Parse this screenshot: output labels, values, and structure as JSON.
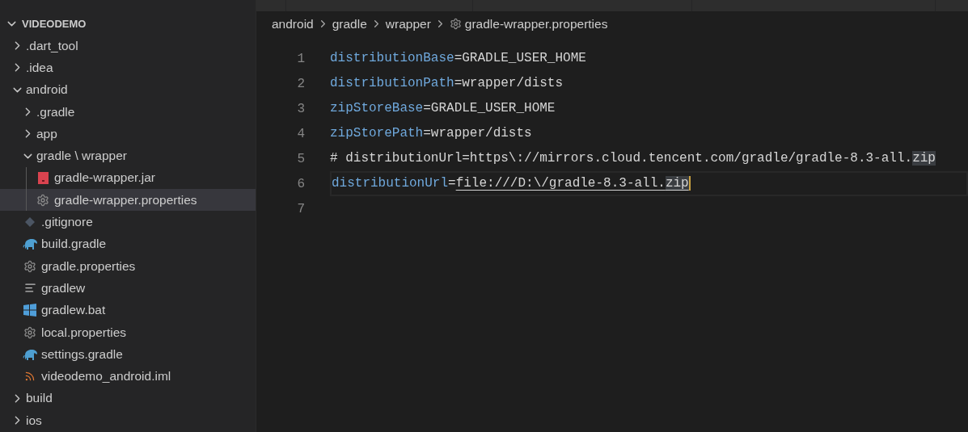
{
  "explorer": {
    "root": {
      "label": "VIDEODEMO",
      "expanded": true
    },
    "items": [
      {
        "kind": "folder",
        "label": ".dart_tool",
        "expanded": false,
        "selected": false
      },
      {
        "kind": "folder",
        "label": ".idea",
        "expanded": false,
        "selected": false
      },
      {
        "kind": "folder",
        "label": "android",
        "expanded": true,
        "selected": false,
        "children": [
          {
            "kind": "folder",
            "label": ".gradle",
            "expanded": false,
            "selected": false
          },
          {
            "kind": "folder",
            "label": "app",
            "expanded": false,
            "selected": false
          },
          {
            "kind": "folder",
            "label": "gradle \\ wrapper",
            "expanded": true,
            "selected": false,
            "children": [
              {
                "kind": "jar",
                "label": "gradle-wrapper.jar",
                "selected": false
              },
              {
                "kind": "config",
                "label": "gradle-wrapper.properties",
                "selected": true
              }
            ]
          },
          {
            "kind": "git",
            "label": ".gitignore",
            "selected": false
          },
          {
            "kind": "gradle",
            "label": "build.gradle",
            "selected": false
          },
          {
            "kind": "config",
            "label": "gradle.properties",
            "selected": false
          },
          {
            "kind": "text",
            "label": "gradlew",
            "selected": false
          },
          {
            "kind": "windows",
            "label": "gradlew.bat",
            "selected": false
          },
          {
            "kind": "config",
            "label": "local.properties",
            "selected": false
          },
          {
            "kind": "gradle",
            "label": "settings.gradle",
            "selected": false
          },
          {
            "kind": "feed",
            "label": "videodemo_android.iml",
            "selected": false
          }
        ]
      },
      {
        "kind": "folder",
        "label": "build",
        "expanded": false,
        "selected": false
      },
      {
        "kind": "folder",
        "label": "ios",
        "expanded": false,
        "selected": false
      }
    ]
  },
  "breadcrumb": [
    "android",
    "gradle",
    "wrapper",
    "gradle-wrapper.properties"
  ],
  "editor": {
    "lines": [
      {
        "number": "1",
        "current": false,
        "segments": [
          {
            "kind": "key",
            "text": "distributionBase"
          },
          {
            "kind": "value",
            "text": "=GRADLE_USER_HOME"
          }
        ]
      },
      {
        "number": "2",
        "current": false,
        "segments": [
          {
            "kind": "key",
            "text": "distributionPath"
          },
          {
            "kind": "value",
            "text": "=wrapper/dists"
          }
        ]
      },
      {
        "number": "3",
        "current": false,
        "segments": [
          {
            "kind": "key",
            "text": "zipStoreBase"
          },
          {
            "kind": "value",
            "text": "=GRADLE_USER_HOME"
          }
        ]
      },
      {
        "number": "4",
        "current": false,
        "segments": [
          {
            "kind": "key",
            "text": "zipStorePath"
          },
          {
            "kind": "value",
            "text": "=wrapper/dists"
          }
        ]
      },
      {
        "number": "5",
        "current": false,
        "segments": [
          {
            "kind": "comment",
            "text": "# distributionUrl=https\\://mirrors.cloud.tencent.com/gradle/gradle-8.3-all."
          },
          {
            "kind": "match",
            "text": "zip"
          }
        ]
      },
      {
        "number": "6",
        "current": true,
        "segments": [
          {
            "kind": "key",
            "text": "distributionUrl"
          },
          {
            "kind": "value",
            "text": "="
          },
          {
            "kind": "link",
            "text": "file:///D:\\/gradle-8.3-all."
          },
          {
            "kind": "link-match",
            "text": "zip"
          }
        ]
      },
      {
        "number": "7",
        "current": false
      }
    ]
  }
}
